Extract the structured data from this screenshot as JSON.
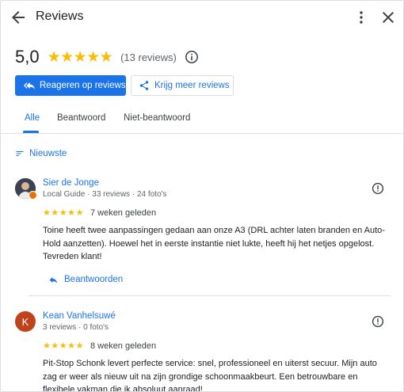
{
  "header": {
    "title": "Reviews",
    "back_icon": "arrow-back-icon",
    "more_icon": "more-vert-icon",
    "close_icon": "close-icon"
  },
  "summary": {
    "rating": "5,0",
    "stars": 5,
    "count_text": "(13 reviews)",
    "info_icon": "info-icon"
  },
  "actions": {
    "reply_label": "Reageren op reviews",
    "get_more_label": "Krijg meer reviews"
  },
  "tabs": [
    {
      "label": "Alle",
      "active": true
    },
    {
      "label": "Beantwoord",
      "active": false
    },
    {
      "label": "Niet-beantwoord",
      "active": false
    }
  ],
  "sort": {
    "label": "Nieuwste",
    "icon": "sort-icon"
  },
  "reviews": [
    {
      "name": "Sier de Jonge",
      "meta": "Local Guide · 33 reviews · 24 foto's",
      "avatar": "photo",
      "stars": 5,
      "date": "7 weken geleden",
      "text": "Toine heeft twee aanpassingen gedaan aan onze A3 (DRL achter laten branden en Auto-Hold aanzetten). Hoewel het in eerste instantie niet lukte, heeft hij het netjes opgelost. Tevreden klant!",
      "reply_label": "Beantwoorden"
    },
    {
      "name": "Kean Vanhelsuwé",
      "meta": "3 reviews · 0 foto's",
      "avatar_letter": "K",
      "stars": 5,
      "date": "8 weken geleden",
      "text": "Pit-Stop Schonk levert perfecte service: snel, professioneel en uiterst secuur. Mijn auto zag er weer als nieuw uit na zijn grondige schoonmaakbeurt. Een betrouwbare en flexibele vakman die ik absoluut aanraad!"
    }
  ],
  "colors": {
    "accent": "#1a73e8",
    "star": "#fbbc04",
    "avatar_k": "#c0421a",
    "local_guide_badge": "#e8710a"
  }
}
